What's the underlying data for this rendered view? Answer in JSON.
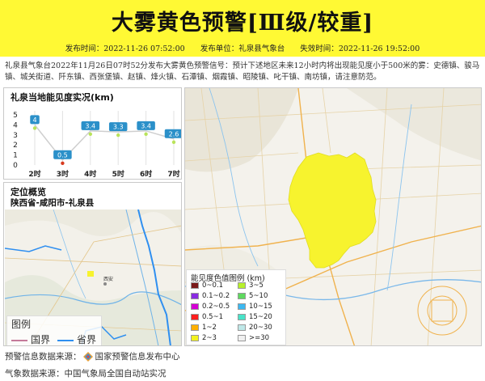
{
  "header": {
    "title": "大雾黄色预警[Ⅲ级/较重]",
    "issue_time_label": "发布时间：",
    "issue_time": "2022-11-26 07:52:00",
    "issuer_label": "发布单位：",
    "issuer": "礼泉县气象台",
    "expire_label": "失效时间：",
    "expire_time": "2022-11-26 19:52:00"
  },
  "description": "礼泉县气象台2022年11月26日07时52分发布大雾黄色预警信号：预计下述地区未来12小时内将出现能见度小于500米的雾：史德镇、骏马镇、城关街道、阡东镇、西张堡镇、赵镇、烽火镇、石潭镇、烟霞镇、昭陵镇、叱干镇、南坊镇，请注意防范。",
  "visibility_panel": {
    "title": "礼泉当地能见度实况(km)"
  },
  "chart_data": {
    "type": "line",
    "title": "礼泉当地能见度实况(km)",
    "xlabel": "",
    "ylabel": "",
    "categories": [
      "2时",
      "3时",
      "4时",
      "5时",
      "6时",
      "7时"
    ],
    "values": [
      4,
      0.5,
      3.4,
      3.3,
      3.4,
      2.6
    ],
    "value_labels": [
      "4",
      "0.5",
      "3.4",
      "3.3",
      "3.4",
      "2.6"
    ],
    "yticks": [
      "0",
      "1",
      "2",
      "3",
      "4",
      "5"
    ],
    "ylim": [
      0,
      5
    ],
    "grid": "vertical",
    "colors": {
      "line": "#cfcfcf",
      "label_bg": "#2b90c9",
      "point_good": "#b9e35a",
      "point_bad": "#d83a1e"
    }
  },
  "location_panel": {
    "title": "定位概览",
    "path": "陕西省-咸阳市-礼泉县",
    "place_label": "西安"
  },
  "mini_legend": {
    "title": "图例",
    "items": [
      {
        "label": "国界",
        "color": "#c57a9a"
      },
      {
        "label": "省界",
        "color": "#2f8ff0"
      }
    ]
  },
  "map_legend": {
    "title": "能见度色值图例 (km)",
    "left": [
      {
        "label": "0~0.1",
        "color": "#7a1a1a"
      },
      {
        "label": "0.1~0.2",
        "color": "#8a2be2"
      },
      {
        "label": "0.2~0.5",
        "color": "#d400d4"
      },
      {
        "label": "0.5~1",
        "color": "#ff1f1f"
      },
      {
        "label": "1~2",
        "color": "#ffb000"
      },
      {
        "label": "2~3",
        "color": "#f2f21f"
      }
    ],
    "right": [
      {
        "label": "3~5",
        "color": "#b7f02a"
      },
      {
        "label": "5~10",
        "color": "#5fd95f"
      },
      {
        "label": "10~15",
        "color": "#3cb8f0"
      },
      {
        "label": "15~20",
        "color": "#48e3c8"
      },
      {
        "label": "20~30",
        "color": "#bfe8e8"
      },
      {
        "label": ">=30",
        "color": "#f0f0f0"
      }
    ]
  },
  "footer": {
    "warning_source_label": "预警信息数据来源：",
    "warning_source": "国家预警信息发布中心",
    "weather_source_label": "气象数据来源：",
    "weather_source": "中国气象局全国自动站实况"
  },
  "colors": {
    "header_bg": "#fff934",
    "warning_area": "#f7f32e"
  }
}
